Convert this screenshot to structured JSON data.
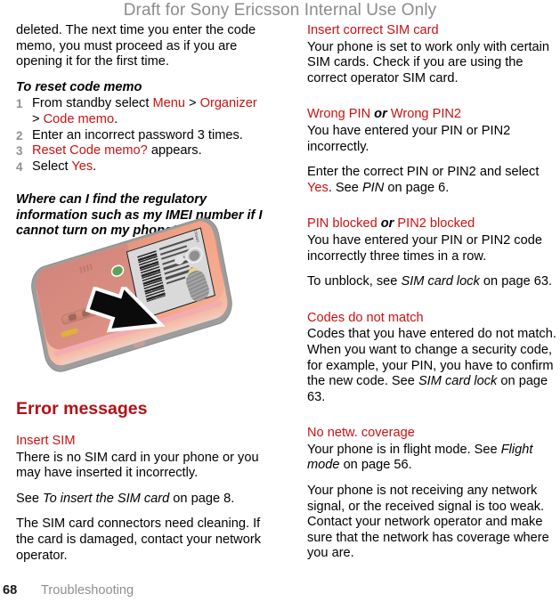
{
  "header": {
    "watermark": "Draft for Sony Ericsson Internal Use Only"
  },
  "left_column": {
    "intro_paragraph": "deleted. The next time you enter the code memo, you must proceed as if you are opening it for the first time.",
    "reset_heading": "To reset code memo",
    "steps": [
      {
        "num": "1",
        "pre": "From standby select ",
        "t1": "Menu",
        "sep1": " > ",
        "t2": "Organizer",
        "sep2": " > ",
        "t3": "Code memo",
        "post": "."
      },
      {
        "num": "2",
        "pre": "Enter an incorrect password 3 times.",
        "t1": "",
        "sep1": "",
        "t2": "",
        "sep2": "",
        "t3": "",
        "post": ""
      },
      {
        "num": "3",
        "pre": "",
        "t1": "Reset Code memo?",
        "sep1": "",
        "t2": "",
        "sep2": "",
        "t3": "",
        "post": " appears."
      },
      {
        "num": "4",
        "pre": "Select ",
        "t1": "Yes",
        "sep1": "",
        "t2": "",
        "sep2": "",
        "t3": "",
        "post": "."
      }
    ],
    "question_heading": "Where can I find the regulatory information such as my IMEI number if I cannot turn on my phone?",
    "illustration": {
      "name": "phone-back-imei-label",
      "label_brand": "Sony Ericsson",
      "arrow": "black-arrow-pointing-to-label"
    },
    "section_title": "Error messages",
    "insert_sim": {
      "heading": "Insert SIM",
      "p1": "There is no SIM card in your phone or you may have inserted it incorrectly.",
      "p2_pre": "See ",
      "p2_italic": "To insert the SIM card",
      "p2_post": " on page 8.",
      "p3": "The SIM card connectors need cleaning. If the card is damaged, contact your network operator."
    }
  },
  "right_column": {
    "insert_correct_sim": {
      "heading": "Insert correct SIM card",
      "p1": "Your phone is set to work only with certain SIM cards. Check if you are using the correct operator SIM card."
    },
    "wrong_pin": {
      "heading_a": "Wrong PIN",
      "heading_or": "or",
      "heading_b": "Wrong PIN2",
      "p1": "You have entered your PIN or PIN2 incorrectly.",
      "p2_pre": "Enter the correct PIN or PIN2 and select ",
      "p2_red": "Yes",
      "p2_mid": ". See ",
      "p2_italic": "PIN",
      "p2_post": " on page 6."
    },
    "pin_blocked": {
      "heading_a": "PIN blocked",
      "heading_or": "or",
      "heading_b": "PIN2 blocked",
      "p1": "You have entered your PIN or PIN2 code incorrectly three times in a row.",
      "p2_pre": "To unblock, see ",
      "p2_italic": "SIM card lock",
      "p2_post": " on page 63."
    },
    "codes_do_not_match": {
      "heading": "Codes do not match",
      "p1_pre": "Codes that you have entered do not match. When you want to change a security code, for example, your PIN, you have to confirm the new code. See ",
      "p1_italic": "SIM card lock",
      "p1_post": " on page 63."
    },
    "no_network": {
      "heading": "No netw. coverage",
      "p1_pre": "Your phone is in flight mode. See ",
      "p1_italic": "Flight mode",
      "p1_post": " on page 56.",
      "p2": "Your phone is not receiving any network signal, or the received signal is too weak. Contact your network operator and make sure that the network has coverage where you are."
    }
  },
  "footer": {
    "page_number": "68",
    "section_name": "Troubleshooting"
  },
  "colors": {
    "ui_term_red": "#cc1111",
    "section_heading_red": "#b11116",
    "watermark_gray": "#8c8c8c",
    "footer_gray": "#8f8f8f",
    "step_number_gray": "#8f8f8f"
  }
}
